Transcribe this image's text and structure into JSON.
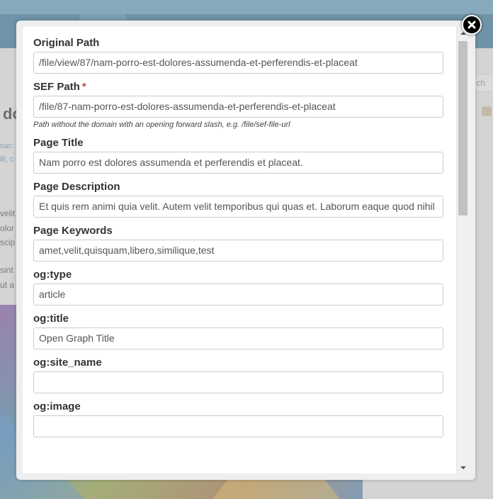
{
  "background": {
    "heading_fragment": "do",
    "link_fragments": [
      "sac",
      "lit, c"
    ],
    "text_fragments": [
      "velit",
      "olor",
      "scip",
      "sint",
      "ut a"
    ],
    "search_fragment": "ch"
  },
  "form": {
    "fields": [
      {
        "label": "Original Path",
        "value": "/file/view/87/nam-porro-est-dolores-assumenda-et-perferendis-et-placeat",
        "required": false
      },
      {
        "label": "SEF Path",
        "value": "/file/87-nam-porro-est-dolores-assumenda-et-perferendis-et-placeat",
        "required": true,
        "help": "Path without the domain with an opening forward slash, e.g. /file/sef-file-url"
      },
      {
        "label": "Page Title",
        "value": "Nam porro est dolores assumenda et perferendis et placeat.",
        "required": false
      },
      {
        "label": "Page Description",
        "value": "Et quis rem animi quia velit. Autem velit temporibus qui quas et. Laborum eaque quod nihil",
        "required": false
      },
      {
        "label": "Page Keywords",
        "value": "amet,velit,quisquam,libero,similique,test",
        "required": false
      },
      {
        "label": "og:type",
        "value": "article",
        "required": false
      },
      {
        "label": "og:title",
        "value": "Open Graph Title",
        "required": false
      },
      {
        "label": "og:site_name",
        "value": "",
        "required": false
      },
      {
        "label": "og:image",
        "value": "",
        "required": false
      }
    ],
    "required_marker": "*"
  },
  "icons": {
    "close": "close-icon",
    "scroll_up": "chevron-up-icon",
    "scroll_down": "chevron-down-icon"
  },
  "colors": {
    "required_marker": "#b94a48",
    "label_text": "#333333",
    "input_border": "#cccccc"
  }
}
